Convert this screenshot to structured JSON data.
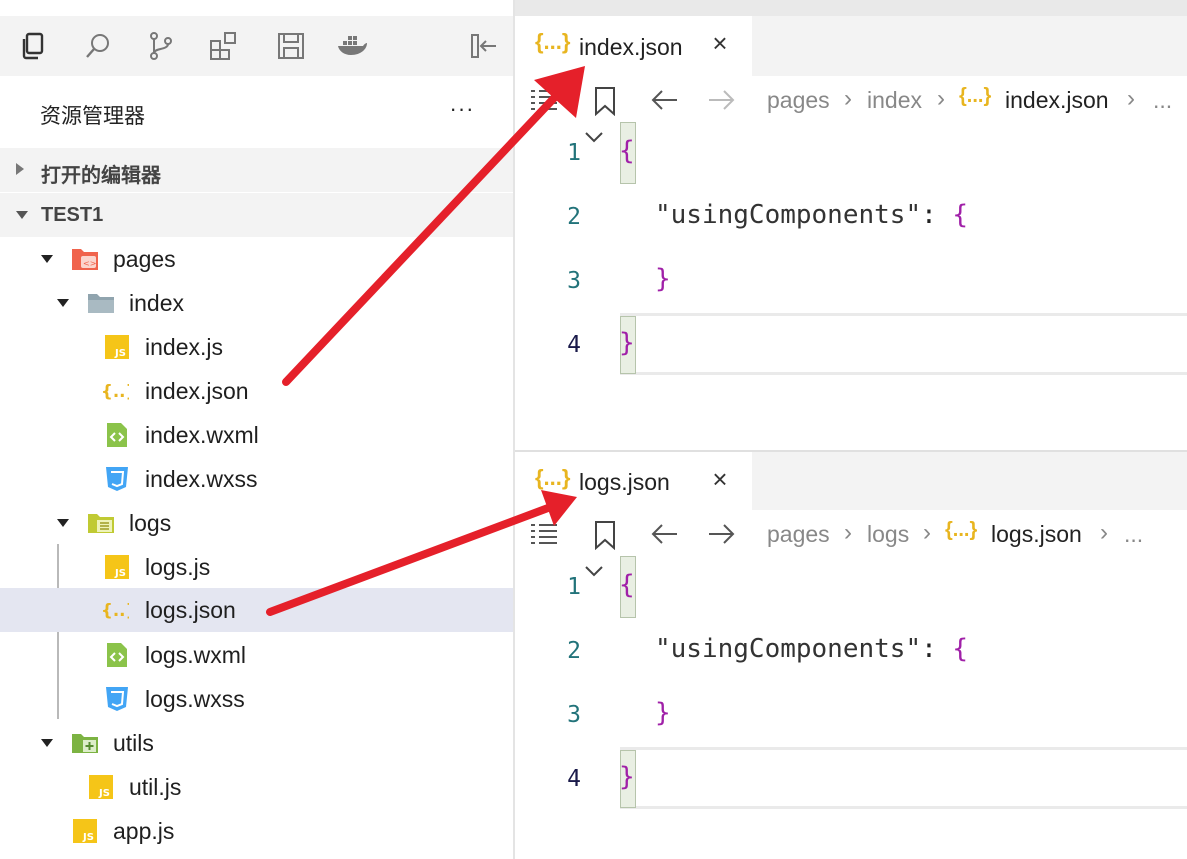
{
  "sidebar": {
    "title": "资源管理器",
    "more": "···",
    "sections": {
      "open_editors": "打开的编辑器",
      "project": "TEST1"
    },
    "tree": [
      {
        "label": "pages",
        "icon": "pages-folder-icon"
      },
      {
        "label": "index",
        "icon": "folder-icon"
      },
      {
        "label": "index.js",
        "icon": "js-file-icon"
      },
      {
        "label": "index.json",
        "icon": "json-file-icon"
      },
      {
        "label": "index.wxml",
        "icon": "wxml-file-icon"
      },
      {
        "label": "index.wxss",
        "icon": "wxss-file-icon"
      },
      {
        "label": "logs",
        "icon": "logs-folder-icon"
      },
      {
        "label": "logs.js",
        "icon": "js-file-icon"
      },
      {
        "label": "logs.json",
        "icon": "json-file-icon"
      },
      {
        "label": "logs.wxml",
        "icon": "wxml-file-icon"
      },
      {
        "label": "logs.wxss",
        "icon": "wxss-file-icon"
      },
      {
        "label": "utils",
        "icon": "utils-folder-icon"
      },
      {
        "label": "util.js",
        "icon": "js-file-icon"
      },
      {
        "label": "app.js",
        "icon": "js-file-icon"
      }
    ]
  },
  "editors": [
    {
      "tab": {
        "braces": "{...}",
        "title": "index.json",
        "close": "×"
      },
      "breadcrumb": {
        "seg1": "pages",
        "seg2": "index",
        "braces": "{...}",
        "seg3": "index.json",
        "more": "..."
      },
      "lines": {
        "n1": "1",
        "n2": "2",
        "n3": "3",
        "n4": "4",
        "l1": "{",
        "l2_str": "\"usingComponents\"",
        "l2_colon": ": ",
        "l2_brace": "{",
        "l3": "}",
        "l4": "}"
      }
    },
    {
      "tab": {
        "braces": "{...}",
        "title": "logs.json",
        "close": "×"
      },
      "breadcrumb": {
        "seg1": "pages",
        "seg2": "logs",
        "braces": "{...}",
        "seg3": "logs.json",
        "more": "..."
      },
      "lines": {
        "n1": "1",
        "n2": "2",
        "n3": "3",
        "n4": "4",
        "l1": "{",
        "l2_str": "\"usingComponents\"",
        "l2_colon": ": ",
        "l2_brace": "{",
        "l3": "}",
        "l4": "}"
      }
    }
  ],
  "colors": {
    "accent_arrow": "#e5202a",
    "json_icon": "#e8b520",
    "selected_row": "#e4e6f1",
    "bracket_purple": "#a020a8",
    "line_number": "#22737a"
  }
}
